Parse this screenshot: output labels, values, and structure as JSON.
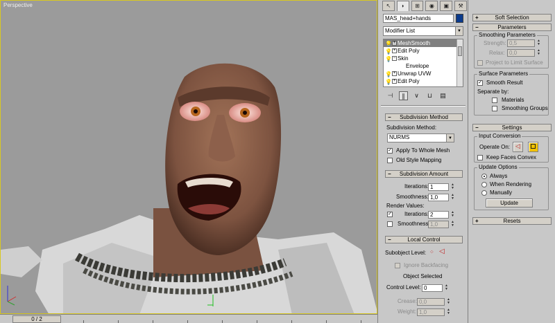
{
  "viewport": {
    "label": "Perspective",
    "time_slider": "0 / 2"
  },
  "command_panel": {
    "tabs": [
      "create-icon",
      "modify-icon",
      "hierarchy-icon",
      "motion-icon",
      "display-icon",
      "utilities-icon"
    ],
    "object_name": "MAS_head+hands",
    "object_color": "#0a3a8c",
    "modifier_list": "Modifier List",
    "stack": [
      {
        "label": "MeshSmooth",
        "selected": true
      },
      {
        "label": "Edit Poly"
      },
      {
        "label": "Skin"
      },
      {
        "label": "Envelope",
        "sub": true
      },
      {
        "label": "Unwrap UVW"
      },
      {
        "label": "Edit Poly"
      }
    ],
    "subdivision_method": {
      "title": "Subdivision Method",
      "method_label": "Subdivision Method:",
      "method_value": "NURMS",
      "apply_whole_mesh": "Apply To Whole Mesh",
      "old_style": "Old Style Mapping"
    },
    "subdivision_amount": {
      "title": "Subdivision Amount",
      "iterations_label": "Iterations:",
      "iterations_value": "1",
      "smoothness_label": "Smoothness:",
      "smoothness_value": "1,0",
      "render_values": "Render Values:",
      "render_iterations_label": "Iterations:",
      "render_iterations_value": "2",
      "render_smoothness_label": "Smoothness",
      "render_smoothness_value": "1,0"
    },
    "local_control": {
      "title": "Local Control",
      "subobject_label": "Subobject Level:",
      "ignore_backfacing": "Ignore Backfacing",
      "status": "Object Selected",
      "control_level_label": "Control Level:",
      "control_level_value": "0",
      "crease_label": "Crease:",
      "crease_value": "0,0",
      "weight_label": "Weight:",
      "weight_value": "1,0"
    }
  },
  "right_panel": {
    "soft_selection": "Soft Selection",
    "parameters": {
      "title": "Parameters",
      "smoothing_group": "Smoothing Parameters",
      "strength_label": "Strength:",
      "strength_value": "0,5",
      "relax_label": "Relax:",
      "relax_value": "0,0",
      "project_limit": "Project to Limit Surface",
      "surface_group": "Surface Parameters",
      "smooth_result": "Smooth Result",
      "separate_by": "Separate by:",
      "materials": "Materials",
      "smoothing_groups": "Smoothing Groups"
    },
    "settings": {
      "title": "Settings",
      "input_group": "Input Conversion",
      "operate_on": "Operate On:",
      "keep_convex": "Keep Faces Convex",
      "update_group": "Update Options",
      "always": "Always",
      "when_rendering": "When Rendering",
      "manually": "Manually",
      "update_button": "Update"
    },
    "resets": "Resets"
  }
}
